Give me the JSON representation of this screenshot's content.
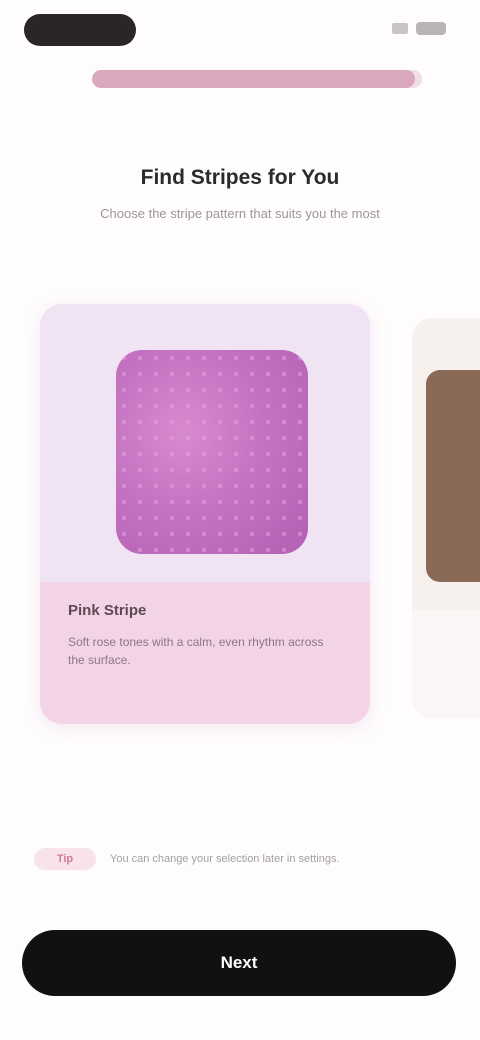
{
  "header": {
    "progress": 0.98
  },
  "screen": {
    "title": "Find Stripes for You",
    "subtitle": "Choose the stripe pattern that suits you the most"
  },
  "carousel": {
    "cards": [
      {
        "name": "Pink Stripe",
        "description": "Soft rose tones with a calm, even rhythm across the surface.",
        "accent": "#c46fc0"
      },
      {
        "name": "",
        "description": "",
        "accent": "#8a6a57"
      }
    ]
  },
  "footer": {
    "tag_label": "Tip",
    "note": "You can change your selection later in settings.",
    "cta_label": "Next"
  }
}
